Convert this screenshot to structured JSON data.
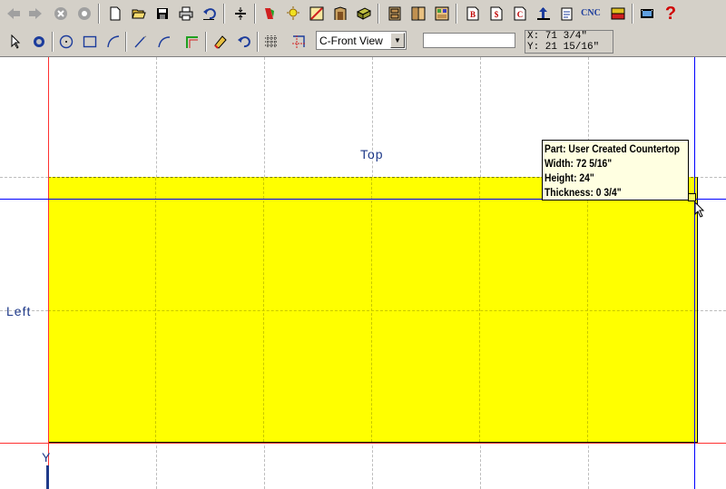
{
  "toolbar1": {
    "buttons": [
      {
        "name": "back",
        "glyph": "⬅"
      },
      {
        "name": "forward",
        "glyph": "➡"
      },
      {
        "name": "stop",
        "glyph": "✖"
      },
      {
        "name": "refresh",
        "glyph": "◉"
      },
      {
        "name": "new",
        "glyph": "🗋"
      },
      {
        "name": "open",
        "glyph": "📂"
      },
      {
        "name": "save",
        "glyph": "💾"
      },
      {
        "name": "print",
        "glyph": "🖶"
      },
      {
        "name": "undo",
        "glyph": "↶"
      },
      {
        "name": "align",
        "glyph": "⇅"
      },
      {
        "name": "materials",
        "glyph": "🎨"
      },
      {
        "name": "lighting",
        "glyph": "💡"
      },
      {
        "name": "edge",
        "glyph": "◪"
      },
      {
        "name": "door",
        "glyph": "▥"
      },
      {
        "name": "part",
        "glyph": "◧"
      },
      {
        "name": "cabinet1",
        "glyph": "▦"
      },
      {
        "name": "cabinet2",
        "glyph": "▤"
      },
      {
        "name": "cabinet3",
        "glyph": "▩"
      },
      {
        "name": "report-b",
        "glyph": "B"
      },
      {
        "name": "report-dollar",
        "glyph": "$"
      },
      {
        "name": "report-c",
        "glyph": "C"
      },
      {
        "name": "export",
        "glyph": "⇪"
      },
      {
        "name": "notes",
        "glyph": "✎"
      },
      {
        "name": "cnc",
        "glyph": "CNC"
      },
      {
        "name": "layout",
        "glyph": "▣"
      },
      {
        "name": "film",
        "glyph": "🎞"
      },
      {
        "name": "help",
        "glyph": "?"
      }
    ]
  },
  "toolbar2": {
    "view_select": "C-Front View",
    "coords": {
      "x": "X: 71 3/4\"",
      "y": "Y: 21 15/16\""
    }
  },
  "canvas": {
    "label_top": "Top",
    "label_left": "Left",
    "axis_label": "Y",
    "tooltip": {
      "part": "Part: User Created Countertop",
      "width": "Width: 72 5/16\"",
      "height": "Height: 24\"",
      "thickness": "Thickness: 0 3/4\""
    }
  },
  "colors": {
    "part_fill": "#ffff00",
    "origin_line": "#ff3030",
    "cursor_line": "#0000ff",
    "label": "#1f3a8a"
  }
}
